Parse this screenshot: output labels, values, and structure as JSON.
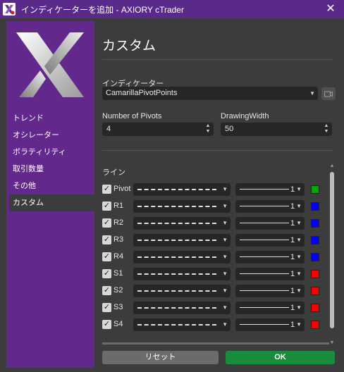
{
  "window": {
    "title": "インディケーターを追加 - AXIORY cTrader",
    "close_glyph": "✕"
  },
  "sidebar": {
    "items": [
      {
        "label": "トレンド",
        "active": false
      },
      {
        "label": "オシレーター",
        "active": false
      },
      {
        "label": "ボラティリティ",
        "active": false
      },
      {
        "label": "取引数量",
        "active": false
      },
      {
        "label": "その他",
        "active": false
      },
      {
        "label": "カスタム",
        "active": true
      }
    ]
  },
  "main": {
    "heading": "カスタム",
    "indicator_label": "インディケーター",
    "indicator_value": "CamarillaPivotPoints",
    "pivots_label": "Number of Pivots",
    "pivots_value": "4",
    "width_label": "DrawingWidth",
    "width_value": "50",
    "lines_label": "ライン",
    "lines": [
      {
        "name": "Pivot",
        "checked": true,
        "width": "1",
        "color": "#00aa00"
      },
      {
        "name": "R1",
        "checked": true,
        "width": "1",
        "color": "#0000ff"
      },
      {
        "name": "R2",
        "checked": true,
        "width": "1",
        "color": "#0000ff"
      },
      {
        "name": "R3",
        "checked": true,
        "width": "1",
        "color": "#0000ff"
      },
      {
        "name": "R4",
        "checked": true,
        "width": "1",
        "color": "#0000ff"
      },
      {
        "name": "S1",
        "checked": true,
        "width": "1",
        "color": "#ff0000"
      },
      {
        "name": "S2",
        "checked": true,
        "width": "1",
        "color": "#ff0000"
      },
      {
        "name": "S3",
        "checked": true,
        "width": "1",
        "color": "#ff0000"
      },
      {
        "name": "S4",
        "checked": true,
        "width": "1",
        "color": "#ff0000"
      }
    ],
    "reset_label": "リセット",
    "ok_label": "OK"
  },
  "colors": {
    "titlebar": "#5a2a8a",
    "sidebar": "#62288c",
    "panel": "#3c3c3c",
    "ok": "#1a8c3e"
  },
  "icons": [
    "app-logo-icon",
    "close-icon",
    "camera-icon",
    "chevron-down-icon",
    "spin-arrows-icon",
    "checkbox-icon"
  ]
}
